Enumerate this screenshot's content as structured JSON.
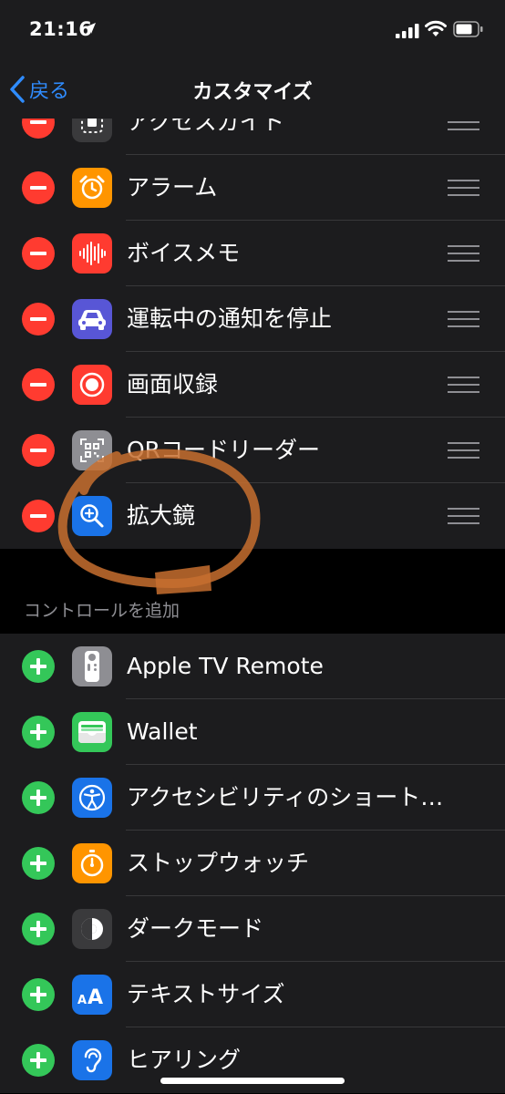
{
  "status": {
    "time": "21:16"
  },
  "nav": {
    "back_label": "戻る",
    "title": "カスタマイズ"
  },
  "included": [
    {
      "label": "アクセスガイド",
      "icon": "guided-access-icon",
      "color": "#3a3a3c"
    },
    {
      "label": "アラーム",
      "icon": "alarm-icon",
      "color": "#ff9500"
    },
    {
      "label": "ボイスメモ",
      "icon": "voice-memo-icon",
      "color": "#ff3b30"
    },
    {
      "label": "運転中の通知を停止",
      "icon": "car-icon",
      "color": "#5856d6"
    },
    {
      "label": "画面収録",
      "icon": "screen-record-icon",
      "color": "#ff3b30"
    },
    {
      "label": "QRコードリーダー",
      "icon": "qr-code-icon",
      "color": "#8e8e93"
    },
    {
      "label": "拡大鏡",
      "icon": "magnifier-icon",
      "color": "#1a73e8"
    }
  ],
  "more_header": "コントロールを追加",
  "more": [
    {
      "label": "Apple TV Remote",
      "icon": "tv-remote-icon",
      "color": "#8e8e93"
    },
    {
      "label": "Wallet",
      "icon": "wallet-icon",
      "color": "#34c759"
    },
    {
      "label": "アクセシビリティのショートカット",
      "icon": "accessibility-icon",
      "color": "#1a73e8"
    },
    {
      "label": "ストップウォッチ",
      "icon": "stopwatch-icon",
      "color": "#ff9500"
    },
    {
      "label": "ダークモード",
      "icon": "dark-mode-icon",
      "color": "#3a3a3c"
    },
    {
      "label": "テキストサイズ",
      "icon": "text-size-icon",
      "color": "#1a73e8"
    },
    {
      "label": "ヒアリング",
      "icon": "hearing-icon",
      "color": "#1a73e8"
    }
  ]
}
